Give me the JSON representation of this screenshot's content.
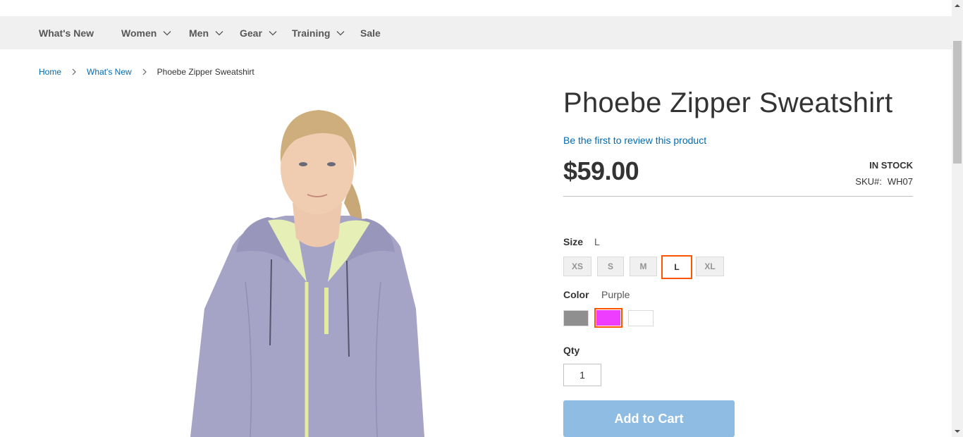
{
  "nav": {
    "items": [
      {
        "label": "What's New",
        "has_dropdown": false
      },
      {
        "label": "Women",
        "has_dropdown": true
      },
      {
        "label": "Men",
        "has_dropdown": true
      },
      {
        "label": "Gear",
        "has_dropdown": true
      },
      {
        "label": "Training",
        "has_dropdown": true
      },
      {
        "label": "Sale",
        "has_dropdown": false
      }
    ]
  },
  "breadcrumb": {
    "home": "Home",
    "category": "What's New",
    "current": "Phoebe Zipper Sweatshirt"
  },
  "product": {
    "title": "Phoebe Zipper Sweatshirt",
    "review_link": "Be the first to review this product",
    "price": "$59.00",
    "stock": "In stock",
    "sku_label": "SKU#:",
    "sku_value": "WH07"
  },
  "options": {
    "size_label": "Size",
    "size_selected": "L",
    "sizes": [
      "XS",
      "S",
      "M",
      "L",
      "XL"
    ],
    "color_label": "Color",
    "color_selected": "Purple",
    "colors": [
      {
        "name": "gray",
        "hex": "#8f8f8f"
      },
      {
        "name": "purple",
        "hex": "#ef3dff"
      },
      {
        "name": "white",
        "hex": "#ffffff"
      }
    ]
  },
  "qty": {
    "label": "Qty",
    "value": "1"
  },
  "cart": {
    "button_label": "Add to Cart"
  },
  "colors": {
    "link": "#006bb4",
    "selected_border": "#ff5501",
    "add_to_cart": "#8fbce2",
    "nav_bg": "#f0f0f0"
  }
}
